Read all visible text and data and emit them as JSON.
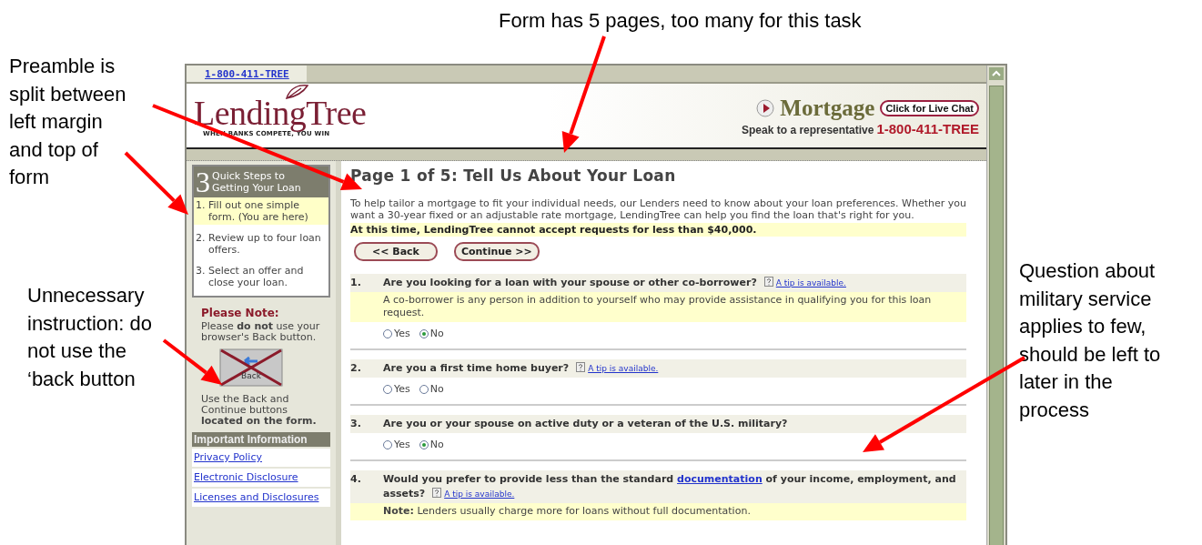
{
  "annotations": [
    {
      "kind": "top",
      "lines": [
        "Form has 5 pages, too many for this task"
      ]
    },
    {
      "kind": "left-upper",
      "lines": [
        "Preamble is",
        "split between",
        "left margin",
        "and top of",
        "form"
      ]
    },
    {
      "kind": "left-lower",
      "lines": [
        "Unnecessary",
        "instruction: do",
        "not use the",
        "‘back button"
      ]
    },
    {
      "kind": "right",
      "lines": [
        "Question about",
        "military service",
        "applies to few,",
        "should be left to",
        "later in the",
        "process"
      ]
    }
  ],
  "top_bar": {
    "phone_link": "1-800-411-TREE"
  },
  "header": {
    "logo": "LendingTree",
    "tagline": "WHEN BANKS COMPETE, YOU WIN",
    "product": "Mortgage",
    "chat_button": "Click for Live Chat",
    "speak_text": "Speak to a representative",
    "phone": "1-800-411-TREE"
  },
  "sidebar": {
    "steps_box": {
      "number": "3",
      "title": "Quick Steps to Getting Your Loan",
      "steps": [
        {
          "num": "1.",
          "text": "Fill out one simple form. (You are here)",
          "selected": true
        },
        {
          "num": "2.",
          "text": "Review up to four loan offers.",
          "selected": false
        },
        {
          "num": "3.",
          "text": "Select an offer and close your loan.",
          "selected": false
        }
      ]
    },
    "note": {
      "heading": "Please Note:",
      "text": "Please **do not** use your browser's Back button.",
      "back_image_label": "Back",
      "text2": "Use the Back and Continue buttons **located on the form.**"
    },
    "info": {
      "heading": "Important Information",
      "links": [
        "Privacy Policy",
        "Electronic Disclosure",
        "Licenses and Disclosures"
      ]
    }
  },
  "main": {
    "title": "Page 1 of 5: Tell Us About Your Loan",
    "intro": "To help tailor a mortgage to fit your individual needs, our Lenders need to know about your loan preferences. Whether you want a 30-year fixed or an adjustable rate mortgage, LendingTree can help you find the loan that's right for you.",
    "notice": "At this time, LendingTree cannot accept requests for less than $40,000.",
    "buttons": [
      "<< Back",
      "Continue >>"
    ],
    "questions": [
      {
        "num": "1.",
        "text": "Are you looking for a loan with your spouse or other co-borrower?",
        "tip": "A tip is available.",
        "note": "A co-borrower is any person in addition to yourself who may provide assistance in qualifying you for this loan request.",
        "options": [
          {
            "label": "Yes",
            "selected": false
          },
          {
            "label": "No",
            "selected": true
          }
        ]
      },
      {
        "num": "2.",
        "text": "Are you a first time home buyer?",
        "tip": "A tip is available.",
        "options": [
          {
            "label": "Yes",
            "selected": false
          },
          {
            "label": "No",
            "selected": false
          }
        ]
      },
      {
        "num": "3.",
        "text": "Are you or your spouse on active duty or a veteran of the U.S. military?",
        "options": [
          {
            "label": "Yes",
            "selected": false
          },
          {
            "label": "No",
            "selected": true
          }
        ]
      },
      {
        "num": "4.",
        "text": "Would you prefer to provide less than the standard",
        "link": "documentation",
        "text_after": "of your income, employment, and assets?",
        "tip": "A tip is available.",
        "note": "**Note:** Lenders usually charge more for loans without full documentation."
      }
    ]
  }
}
